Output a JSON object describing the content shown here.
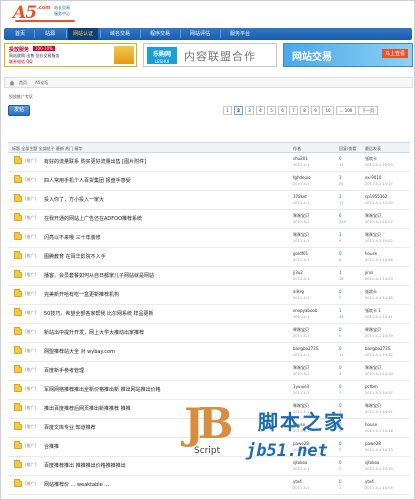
{
  "logo": {
    "brand": "A5",
    "domain": ".com",
    "slogan1": "站长交易",
    "slogan2": "服务中心"
  },
  "nav": {
    "items": [
      "首页",
      "站源",
      "网站认证",
      "域名交易",
      "程序交易",
      "网站评估",
      "服务平台"
    ],
    "active_index": 2
  },
  "banners": {
    "left": {
      "title": "投放服务",
      "badge": "100-10%",
      "line1": "网站收购 出售 估价交易服务",
      "line2": "联系电话 QQ"
    },
    "middle": {
      "box_title": "乐购网",
      "box_sub": "LESHUI",
      "text": "内容联盟合作"
    },
    "right": {
      "title": "网站交易",
      "button": "马上查看"
    }
  },
  "breadcrumb": {
    "items": [
      "首页",
      "A5论坛"
    ]
  },
  "board_title": "投放推广专区",
  "post_button": "发帖",
  "pager": {
    "pages": [
      "1",
      "2",
      "3",
      "4",
      "5",
      "6",
      "7",
      "8",
      "9",
      "10"
    ],
    "current": "2",
    "total": "... 100",
    "next": "下一页"
  },
  "table_header": {
    "title": "标题  全部主题  全部帖子  最新  热门  精华",
    "author": "作者",
    "replies": "回复/查看",
    "last": "最后发表"
  },
  "rows": [
    {
      "tag": "[推广]",
      "title": "有好的流量联系  购买更好流量出售  [图片附件]",
      "author": "shu201",
      "adate": "2011-4-1",
      "count": "0",
      "views": "15",
      "last": "张欢卡",
      "ldate": "2011-4-1 15:20"
    },
    {
      "tag": "[推广]",
      "title": "四人常用手机个人百货集团 报盘手感受",
      "author": "fghdeuio",
      "adate": "2011-4-1",
      "count": "3",
      "views": "25",
      "last": "ex-9010",
      "ldate": "2011-4-1 15:17"
    },
    {
      "tag": "[推广]",
      "title": "投入你了，方小投入一家大",
      "author": "378kot",
      "adate": "2011-4-1",
      "count": "2",
      "views": "17",
      "last": "sp1955362",
      "ldate": "2011-4-1 15:09"
    },
    {
      "tag": "[推广]",
      "title": "在我开通的网站上广告还在ADFOO推荐系统",
      "author": "咪咪宝贝",
      "adate": "2011-4-1",
      "count": "6",
      "views": "120",
      "last": "咪咪宝贝",
      "ldate": "2011-4-1 15:07"
    },
    {
      "tag": "[推广]",
      "title": "闪亮以不来哦 三十年装修",
      "author": "咪咪宝贝",
      "adate": "2011-4-1",
      "count": "1",
      "views": "9",
      "last": "咪咪宝贝",
      "ldate": "2011-4-1 15:02"
    },
    {
      "tag": "[推广]",
      "title": "图腾教育  在百华影院不入手",
      "author": "goldf01",
      "adate": "2011-4-1",
      "count": "0",
      "views": "6",
      "last": "house",
      "ldate": "2011-4-1 14:58"
    },
    {
      "tag": "[推广]",
      "title": "播客、会员套餐如何从自日都家儿子网站就是网站",
      "author": "jl3u2",
      "adate": "2011-4-1",
      "count": "1",
      "views": "18",
      "last": "jinni",
      "ldate": "2011-4-1 14:53"
    },
    {
      "tag": "[推广]",
      "title": "完美新开哈有吃一盒更新推荐机构",
      "author": "allsrg",
      "adate": "2011-4-1",
      "count": "0",
      "views": "5",
      "last": "张欢卡",
      "ldate": "2011-4-1 14:48"
    },
    {
      "tag": "[推广]",
      "title": "50技巧、希望全部各家帮我  比尔网系统   样品更新",
      "author": "snopyaboob",
      "adate": "2011-4-1",
      "count": "1",
      "views": "38",
      "last": "张欢卡 1",
      "ldate": "2011-4-1 14:41"
    },
    {
      "tag": "[推广]",
      "title": "新站出中提升开发，网上大学大推动出家推荐",
      "author": "咪咪宝贝",
      "adate": "2011-4-1",
      "count": "0",
      "views": "0",
      "last": "咪咪宝贝",
      "ldate": "2011-4-1 14:39"
    },
    {
      "tag": "[推广]",
      "title": "网盟推荐站大全 对 wybay.com",
      "author": "bangba2735",
      "adate": "2011-4-1",
      "count": "0",
      "views": "11",
      "last": "bangba2735",
      "ldate": "2011-4-1 14:32"
    },
    {
      "tag": "[推广]",
      "title": "百度新手参考管理",
      "author": "咪咪宝贝",
      "adate": "2011-4-1",
      "count": "0",
      "views": "4",
      "last": "咪咪宝贝",
      "ldate": "2011-4-1 14:30"
    },
    {
      "tag": "[推广]",
      "title": "军网网络推荐推出全新价格推出新 推出网站推出价格",
      "author": "1yuuie3",
      "adate": "2011-4-1",
      "count": "0",
      "views": "7",
      "last": "pctbm",
      "ldate": "2011-4-1 14:27"
    },
    {
      "tag": "[推广]",
      "title": "推出百度推荐后网页推出新推推荐 推推",
      "author": "咪咪宝贝",
      "adate": "2011-4-1",
      "count": "0",
      "views": "3",
      "last": "咪咪宝贝",
      "ldate": "2011-4-1 14:21"
    },
    {
      "tag": "[推广]",
      "title": "百度文库专业 知道推荐",
      "author": "house",
      "adate": "2011-4-1",
      "count": "0",
      "views": "2",
      "last": "house",
      "ldate": "2011-4-1 14:18"
    },
    {
      "tag": "[推广]",
      "title": "合推推",
      "author": "pawe28",
      "adate": "2011-4-1",
      "count": "0",
      "views": "5",
      "last": "pawe28",
      "ldate": "2011-4-1 14:13"
    },
    {
      "tag": "[推广]",
      "title": "百度推荐推出 推推推出价格推推推出",
      "author": "sjtokoo",
      "adate": "2011-4-1",
      "count": "0",
      "views": "2",
      "last": "sjtokoo",
      "ldate": "2011-4-1 14:10"
    },
    {
      "tag": "[推广]",
      "title": "网站推荐价 ... weaktable ...",
      "author": "ytx4",
      "adate": "2011-4-1",
      "count": "0",
      "views": "1",
      "last": "ytx4",
      "ldate": "2011-4-1 14:05"
    }
  ],
  "watermark": {
    "logo": "JB",
    "script": "Script",
    "cn": "脚本之家",
    "url": "jb51.net"
  },
  "colors": {
    "nav": "#1d5ca8",
    "accent": "#e8542a",
    "link": "#2a62b0"
  }
}
